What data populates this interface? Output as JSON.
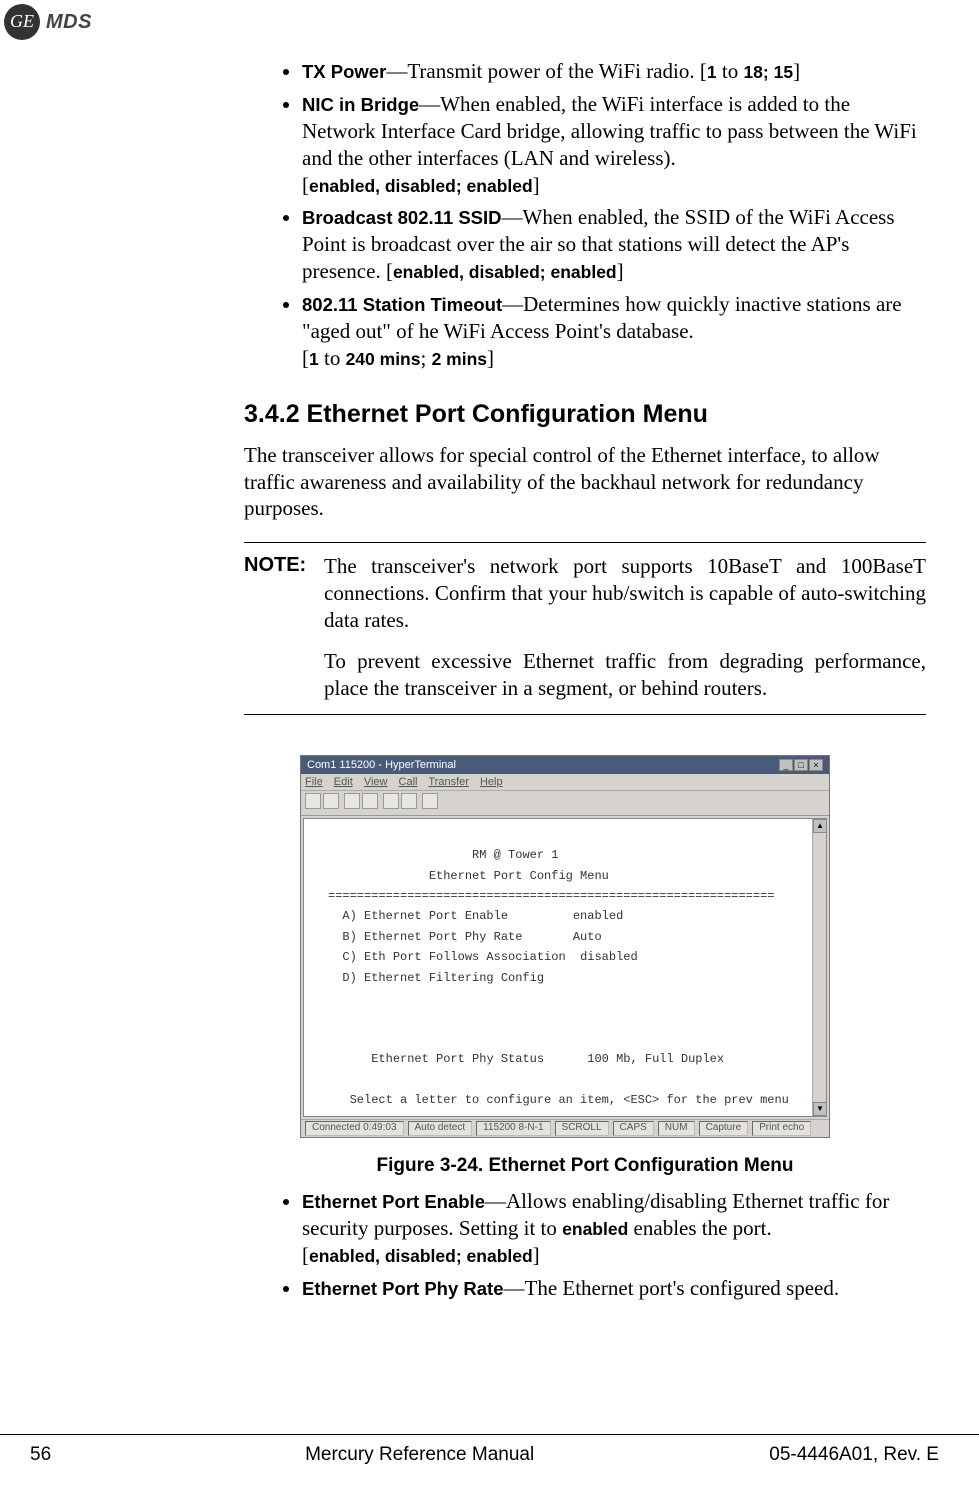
{
  "logo": {
    "ge": "GE",
    "mds": "MDS"
  },
  "bullets_top": [
    {
      "label": "TX Power",
      "sep": "—",
      "desc_prefix": "Transmit power of the WiFi radio. [",
      "range_a": "1",
      "range_mid": " to ",
      "range_b": "18; 15",
      "desc_suffix": "]"
    },
    {
      "label": "NIC in Bridge",
      "sep": "—",
      "desc": "When enabled, the WiFi interface is added to the Network Interface Card bridge, allowing traffic to pass between the WiFi and the other interfaces (LAN and wireless).",
      "opt_open": "[",
      "opt": "enabled, disabled; enabled",
      "opt_close": "]"
    },
    {
      "label": "Broadcast 802.11 SSID",
      "sep": "—",
      "desc_a": "When enabled, the SSID of the WiFi Access Point is broadcast over the air so that stations will detect the AP's presence. [",
      "opt": "enabled, disabled; enabled",
      "desc_b": "]"
    },
    {
      "label": "802.11 Station Timeout",
      "sep": "—",
      "desc": "Determines how quickly inactive sta­tions are \"aged out\" of he WiFi Access Point's database.",
      "r_open": "[",
      "r_a": "1",
      "r_mid": " to ",
      "r_b": "240 mins",
      "r_semi": "; ",
      "r_c": "2 mins",
      "r_close": "]"
    }
  ],
  "heading": "3.4.2 Ethernet Port Configuration Menu",
  "intro": "The transceiver allows for special control of the Ethernet interface, to allow traffic awareness and availability of the backhaul network for redundancy purposes.",
  "note": {
    "label": "NOTE:",
    "p1": "The transceiver's network port supports 10BaseT and 100BaseT connections. Confirm that your hub/switch is capable of auto-switching data rates.",
    "p2": "To prevent excessive Ethernet traffic from degrading perfor­mance, place the transceiver in a segment, or behind routers."
  },
  "terminal": {
    "title": "Com1 115200 - HyperTerminal",
    "menu": {
      "file": "File",
      "edit": "Edit",
      "view": "View",
      "call": "Call",
      "transfer": "Transfer",
      "help": "Help"
    },
    "header1": "RM @ Tower 1",
    "header2": "Ethernet Port Config Menu",
    "divider": "==============================================================",
    "rowA_l": "A) Ethernet Port Enable",
    "rowA_v": "enabled",
    "rowB_l": "B) Ethernet Port Phy Rate",
    "rowB_v": "Auto",
    "rowC_l": "C) Eth Port Follows Association",
    "rowC_v": "disabled",
    "rowD_l": "D) Ethernet Filtering Config",
    "rowD_v": "",
    "status_l": "Ethernet Port Phy Status",
    "status_v": "100 Mb, Full Duplex",
    "prompt": "Select a letter to configure an item, <ESC> for the prev menu",
    "sb_conn": "Connected 0:49:03",
    "sb_auto": "Auto detect",
    "sb_rate": "115200 8-N-1",
    "sb_scroll": "SCROLL",
    "sb_caps": "CAPS",
    "sb_num": "NUM",
    "sb_cap": "Capture",
    "sb_echo": "Print echo"
  },
  "figure_caption": "Figure 3-24. Ethernet Port Configuration Menu",
  "bullets_bot": [
    {
      "label": "Ethernet Port Enable",
      "sep": "—",
      "d1": "Allows enabling/disabling Ethernet traffic for security purposes. Setting it to ",
      "kw": "enabled",
      "d2": " enables the port.",
      "opt_open": "[",
      "opt": "enabled, disabled; enabled",
      "opt_close": "]"
    },
    {
      "label": "Ethernet Port Phy Rate",
      "sep": "—",
      "desc": "The Ethernet port's configured speed."
    }
  ],
  "footer": {
    "page": "56",
    "title": "Mercury Reference Manual",
    "doc": "05-4446A01, Rev. E"
  }
}
